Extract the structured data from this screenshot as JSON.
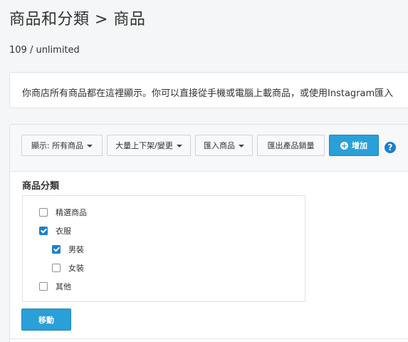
{
  "header": {
    "title": "商品和分類 > 商品"
  },
  "count": "109 / unlimited",
  "info": {
    "text": "你商店所有商品都在這裡顯示。你可以直接從手機或電腦上載商品，或使用Instagram匯入"
  },
  "toolbar": {
    "filter_label": "顯示: 所有商品",
    "bulk_label": "大量上下架/變更",
    "import_label": "匯入商品",
    "export_sales_label": "匯出產品銷量",
    "add_label": "增加",
    "help_label": "?"
  },
  "categories": {
    "title": "商品分類",
    "items": [
      {
        "label": "精選商品",
        "checked": false
      },
      {
        "label": "衣服",
        "checked": true
      },
      {
        "label": "男裝",
        "checked": true
      },
      {
        "label": "女裝",
        "checked": false
      },
      {
        "label": "其他",
        "checked": false
      }
    ]
  },
  "actions": {
    "move_label": "移動"
  },
  "colors": {
    "primary": "#2a9fd8",
    "checkbox_checked": "#1b7fd1"
  }
}
